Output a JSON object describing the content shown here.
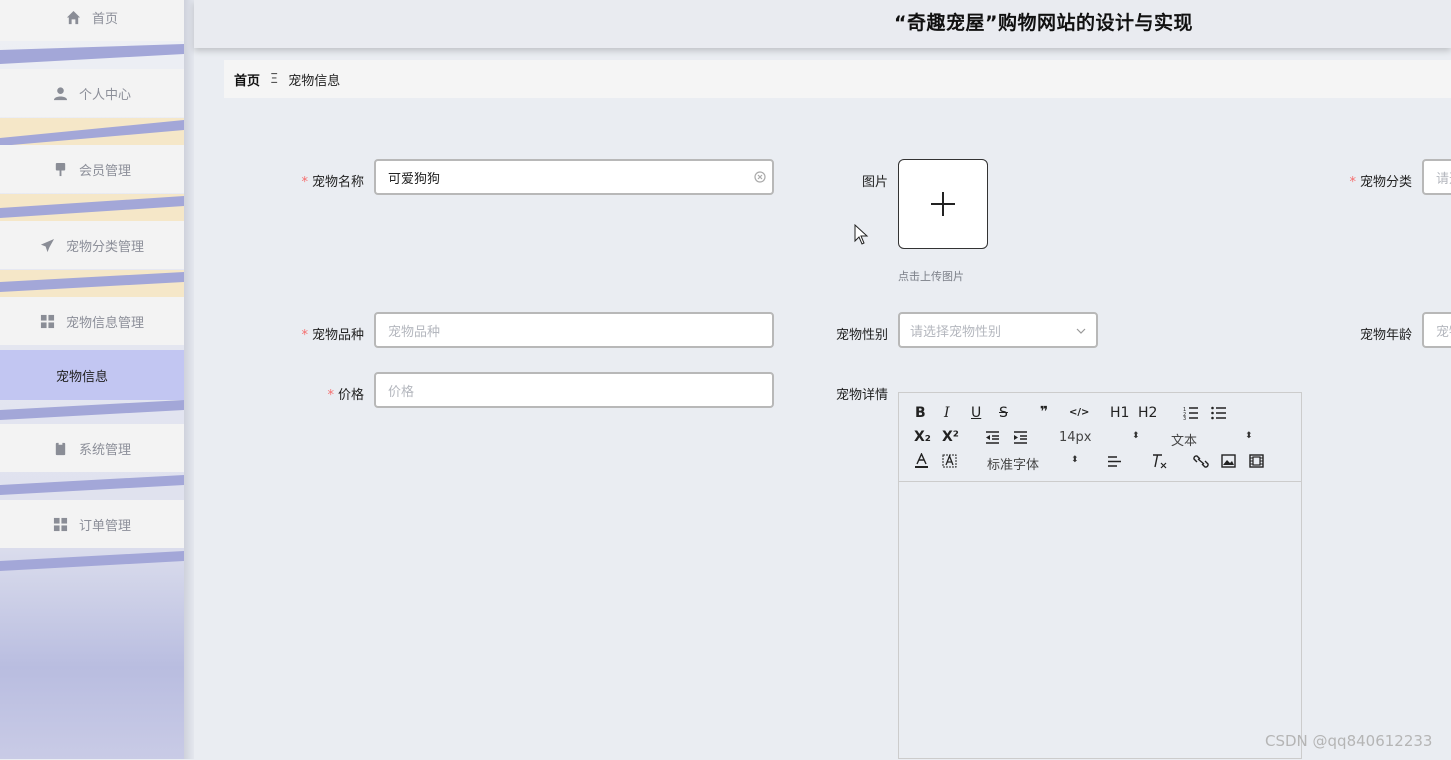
{
  "app_title": "“奇趣宠屋”购物网站的设计与实现",
  "sidebar": {
    "items": [
      {
        "label": "首页",
        "icon": "home-icon"
      },
      {
        "label": "个人中心",
        "icon": "user-icon"
      },
      {
        "label": "会员管理",
        "icon": "brush-icon"
      },
      {
        "label": "宠物分类管理",
        "icon": "paper-plane-icon"
      },
      {
        "label": "宠物信息管理",
        "icon": "grid-icon"
      },
      {
        "label": "系统管理",
        "icon": "clipboard-icon"
      },
      {
        "label": "订单管理",
        "icon": "grid-icon"
      }
    ],
    "active_sub": "宠物信息"
  },
  "breadcrumb": {
    "home": "首页",
    "separator": "Ξ",
    "current": "宠物信息"
  },
  "form": {
    "pet_name": {
      "label": "宠物名称",
      "value": "可爱狗狗",
      "required": true
    },
    "image": {
      "label": "图片",
      "tip": "点击上传图片"
    },
    "pet_category": {
      "label": "宠物分类",
      "placeholder": "请选",
      "required": true
    },
    "pet_breed": {
      "label": "宠物品种",
      "placeholder": "宠物品种",
      "required": true
    },
    "pet_gender": {
      "label": "宠物性别",
      "placeholder": "请选择宠物性别"
    },
    "pet_age": {
      "label": "宠物年龄",
      "placeholder": "宠物"
    },
    "price": {
      "label": "价格",
      "placeholder": "价格",
      "required": true
    },
    "pet_detail": {
      "label": "宠物详情"
    }
  },
  "required_mark": "*",
  "editor": {
    "font_size": "14px",
    "header_select": "文本",
    "font_select": "标准字体",
    "buttons": {
      "bold": "B",
      "italic": "I",
      "underline": "U",
      "strike": "S",
      "quote": "❞",
      "code": "</>",
      "h1": "H1",
      "h2": "H2",
      "sub": "X₂",
      "sup": "X²"
    }
  },
  "watermark": "CSDN @qq840612233",
  "colors": {
    "required": "#f56c6c",
    "active_menu": "#c2c6f2",
    "stripe": "#a3a7d8"
  }
}
